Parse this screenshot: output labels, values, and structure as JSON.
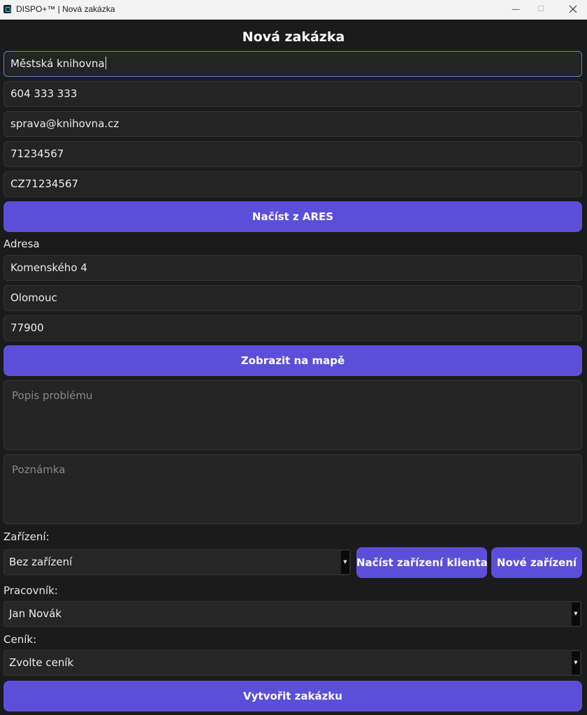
{
  "window": {
    "title": "DISPO+™ | Nová zakázka",
    "minimize_glyph": "—",
    "maximize_glyph": "☐"
  },
  "form": {
    "heading": "Nová zakázka",
    "client_name": "Městská knihovna",
    "phone": "604 333 333",
    "email": "sprava@knihovna.cz",
    "ico": "71234567",
    "dic": "CZ71234567",
    "ares_button": "Načíst z ARES",
    "address_label": "Adresa",
    "street": "Komenského 4",
    "city": "Olomouc",
    "zip": "77900",
    "map_button": "Zobrazit na mapě",
    "problem_placeholder": "Popis problému",
    "note_placeholder": "Poznámka",
    "device_label": "Zařízení:",
    "device_selected": "Bez zařízení",
    "load_devices_button": "Načíst zařízení klienta",
    "new_device_button": "Nové zařízení",
    "worker_label": "Pracovník:",
    "worker_selected": "Jan Novák",
    "pricelist_label": "Ceník:",
    "pricelist_selected": "Zvolte ceník",
    "submit_button": "Vytvořit zakázku"
  },
  "icons": {
    "app": "dispo-app-icon",
    "dropdown": "chevron-down-icon"
  },
  "colors": {
    "accent": "#5b4fd9",
    "background": "#1b1b1b",
    "field": "#242424",
    "focus_border": "#5a82c8"
  }
}
